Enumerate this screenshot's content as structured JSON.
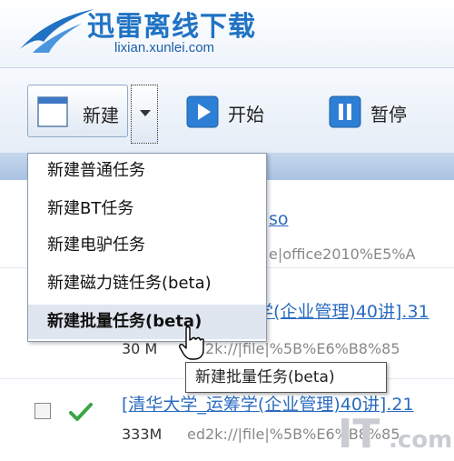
{
  "header": {
    "title": "迅雷离线下载",
    "url": "lixian.xunlei.com"
  },
  "toolbar": {
    "new_label": "新建",
    "start_label": "开始",
    "pause_label": "暂停"
  },
  "menu": {
    "items": [
      "新建普通任务",
      "新建BT任务",
      "新建电驴任务",
      "新建磁力链任务(beta)",
      "新建批量任务(beta)"
    ],
    "active_index": 4
  },
  "tooltip": "新建批量任务(beta)",
  "tasks": [
    {
      "title_fragment": "so",
      "link_fragment": "e|office2010%E5%A"
    },
    {
      "title_fragment": "学(企业管理)40讲].31",
      "size_fragment": "30 M",
      "link_fragment": "ed2k://|file|%5B%E6%B8%85"
    },
    {
      "title": "[清华大学_运筹学(企业管理)40讲].21",
      "size": "333M",
      "link": "ed2k://|file|%5B%E6%B8%85"
    }
  ],
  "watermark": "IT.com.cn",
  "colors": {
    "brand_blue": "#1f72c4",
    "link_blue": "#2a6bbf",
    "check_green": "#3aa646",
    "menu_highlight": "#dfe6f0"
  }
}
